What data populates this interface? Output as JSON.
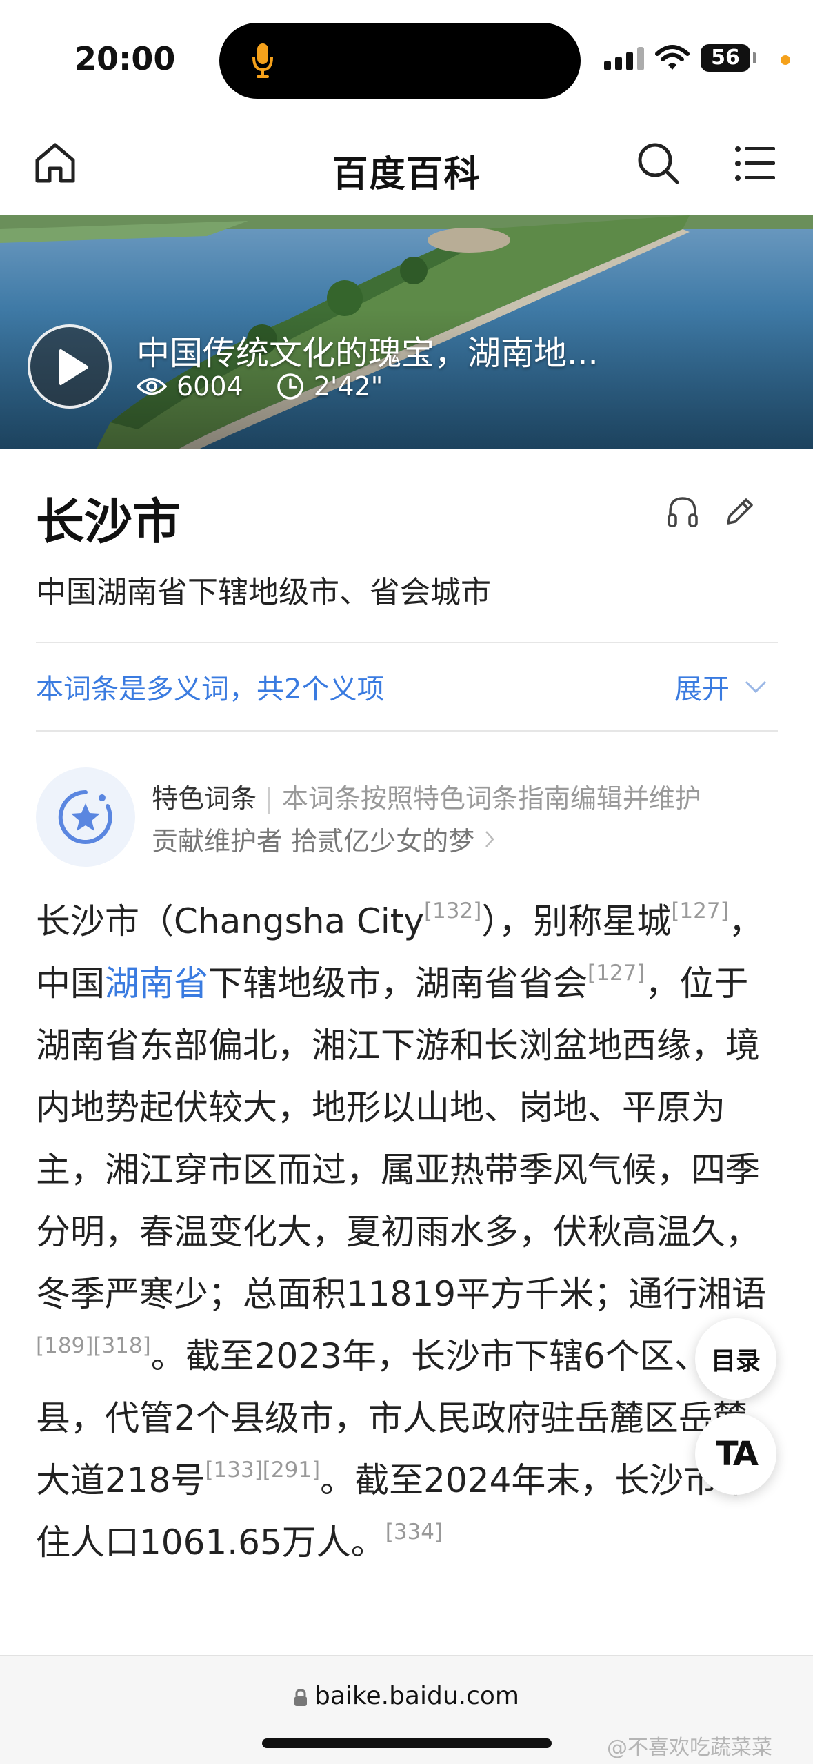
{
  "status_bar": {
    "time": "20:00",
    "battery": "56",
    "icons": [
      "microphone-icon",
      "signal-icon",
      "wifi-icon",
      "battery-icon"
    ]
  },
  "nav": {
    "title": "百度百科",
    "icons": [
      "home-icon",
      "search-icon",
      "menu-icon"
    ]
  },
  "hero": {
    "title": "中国传统文化的瑰宝，湖南地...",
    "views": "6004",
    "duration": "2'42\""
  },
  "entry": {
    "title": "长沙市",
    "subtitle": "中国湖南省下辖地级市、省会城市",
    "polysemy_note": "本词条是多义词，共2个义项",
    "expand_label": "展开"
  },
  "featured": {
    "label": "特色词条",
    "separator": "|",
    "description": "本词条按照特色词条指南编辑并维护",
    "contributor_prefix": "贡献维护者",
    "contributor_name": "拾贰亿少女的梦"
  },
  "body": {
    "s1": "长沙市（Changsha City",
    "r1": "[132]",
    "s2": "），别称星城",
    "r2": "[127]",
    "s3": "，中国",
    "link": "湖南省",
    "s4": "下辖地级市，湖南省省会",
    "r3": "[127]",
    "s5": "，位于湖南省东部偏北，湘江下游和长浏盆地西缘，境内地势起伏较大，地形以山地、岗地、平原为主，湘江穿市区而过，属亚热带季风气候，四季分明，春温变化大，夏初雨水多，伏秋高温久，冬季严寒少；总面积11819平方千米；通行湘语",
    "r4": "[189][318]",
    "s6": "。截至2023年，长沙市下辖6个区、1个县，代管2个县级市，市人民政府驻岳麓区岳麓大道218号",
    "r5": "[133][291]",
    "s7": "。截至2024年末，长沙市常住人口1061.65万人。",
    "r6": "[334]"
  },
  "floating": {
    "toc": "目录",
    "ta": "TA"
  },
  "url_bar": {
    "url": "baike.baidu.com",
    "watermark": "@不喜欢吃蔬菜菜"
  },
  "colors": {
    "link": "#3a7be0",
    "accent_orange": "#f5a11b",
    "muted": "#999999"
  }
}
